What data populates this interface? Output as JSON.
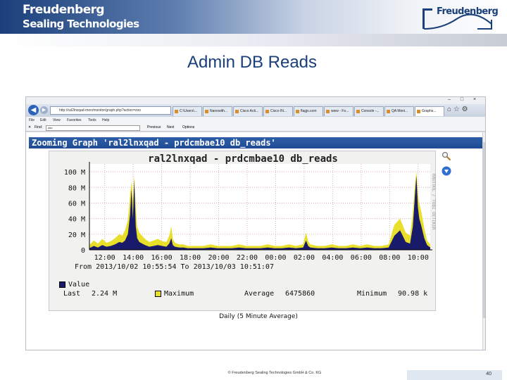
{
  "header": {
    "brand_line1": "Freudenberg",
    "brand_line2": "Sealing Technologies",
    "logo_text": "Freudenberg",
    "accent": "#1a3f7a"
  },
  "slide_title": "Admin DB Reads",
  "browser": {
    "url": "http://ral2lnxqad-mon/monitor/graph.php?action=zoo",
    "tabs": [
      "C:\\Users\\...",
      "Nanowith...",
      "Cisco Acti...",
      "Cisco IN...",
      "flagjs.com",
      "www - Fo...",
      "Console -...",
      "QA Moni...",
      "Graphs..."
    ],
    "menu": [
      "File",
      "Edit",
      "View",
      "Favorites",
      "Tools",
      "Help"
    ],
    "find_label": "Find:",
    "find_value": "zoo",
    "find_previous": "Previous",
    "find_next": "Next",
    "find_options": "Options",
    "window_controls": [
      "–",
      "□",
      "×"
    ]
  },
  "graph": {
    "zoom_header": "Zooming Graph 'ral2lnxqad - prdcmbae10 db_reads'",
    "side_label": "RRDTOOL / TOBI OETIKER",
    "footer_label": "Daily (5 Minute Average)"
  },
  "chart_data": {
    "type": "area",
    "title": "ral2lnxqad - prdcmbae10 db_reads",
    "subtitle": "From 2013/10/02 10:55:54 To 2013/10/03 10:51:07",
    "ylim": [
      0,
      110
    ],
    "y_unit": "M",
    "y_ticks": [
      "0",
      "20 M",
      "40 M",
      "60 M",
      "80 M",
      "100 M"
    ],
    "y_tick_values": [
      0,
      20,
      40,
      60,
      80,
      100
    ],
    "x_ticks": [
      "12:00",
      "14:00",
      "16:00",
      "18:00",
      "20:00",
      "22:00",
      "00:00",
      "02:00",
      "04:00",
      "06:00",
      "08:00",
      "10:00"
    ],
    "x_tick_hours": [
      1.07,
      3.07,
      5.07,
      7.07,
      9.07,
      11.07,
      13.07,
      15.07,
      17.07,
      19.07,
      21.07,
      23.07
    ],
    "x_range_hours": [
      0,
      23.92
    ],
    "grid": true,
    "series": [
      {
        "name": "Value",
        "color": "#1a1a6b",
        "x": [
          0,
          0.3,
          0.6,
          0.9,
          1.2,
          1.5,
          1.8,
          2.1,
          2.3,
          2.5,
          2.7,
          2.85,
          2.95,
          3.05,
          3.15,
          3.25,
          3.35,
          3.5,
          3.7,
          3.9,
          4.2,
          4.5,
          4.8,
          5.1,
          5.4,
          5.6,
          5.75,
          5.85,
          6.0,
          6.3,
          6.6,
          6.9,
          7.2,
          7.5,
          8.0,
          8.5,
          9.0,
          9.5,
          10.0,
          10.5,
          11.0,
          11.5,
          12.0,
          12.5,
          13.0,
          13.5,
          14.0,
          14.5,
          15.0,
          15.2,
          15.35,
          15.5,
          16.0,
          16.5,
          17.0,
          17.5,
          18.0,
          18.5,
          19.0,
          19.5,
          20.0,
          20.5,
          21.0,
          21.4,
          21.8,
          22.2,
          22.5,
          22.7,
          22.85,
          22.95,
          23.05,
          23.15,
          23.3,
          23.5,
          23.7,
          23.92
        ],
        "values": [
          2,
          5,
          3,
          6,
          4,
          5,
          7,
          10,
          9,
          12,
          20,
          45,
          78,
          40,
          90,
          30,
          15,
          10,
          8,
          6,
          4,
          5,
          6,
          5,
          4,
          8,
          15,
          6,
          4,
          3,
          3,
          2,
          2,
          2,
          2,
          3,
          2,
          2,
          2,
          3,
          2,
          2,
          2,
          3,
          2,
          2,
          3,
          2,
          3,
          12,
          5,
          3,
          2,
          2,
          3,
          2,
          2,
          3,
          2,
          3,
          2,
          2,
          3,
          18,
          25,
          10,
          8,
          30,
          70,
          95,
          55,
          40,
          30,
          15,
          6,
          3
        ]
      },
      {
        "name": "Maximum",
        "color": "#e8df2a",
        "x": [
          0,
          0.3,
          0.6,
          0.9,
          1.2,
          1.5,
          1.8,
          2.1,
          2.3,
          2.5,
          2.7,
          2.85,
          2.95,
          3.05,
          3.15,
          3.25,
          3.35,
          3.5,
          3.7,
          3.9,
          4.2,
          4.5,
          4.8,
          5.1,
          5.4,
          5.6,
          5.75,
          5.85,
          6.0,
          6.3,
          6.6,
          6.9,
          7.2,
          7.5,
          8.0,
          8.5,
          9.0,
          9.5,
          10.0,
          10.5,
          11.0,
          11.5,
          12.0,
          12.5,
          13.0,
          13.5,
          14.0,
          14.5,
          15.0,
          15.2,
          15.35,
          15.5,
          16.0,
          16.5,
          17.0,
          17.5,
          18.0,
          18.5,
          19.0,
          19.5,
          20.0,
          20.5,
          21.0,
          21.4,
          21.8,
          22.2,
          22.5,
          22.7,
          22.85,
          22.95,
          23.05,
          23.15,
          23.3,
          23.5,
          23.7,
          23.92
        ],
        "values": [
          6,
          12,
          8,
          14,
          9,
          11,
          15,
          20,
          18,
          25,
          38,
          70,
          88,
          62,
          95,
          55,
          30,
          22,
          18,
          14,
          10,
          12,
          14,
          11,
          10,
          18,
          30,
          14,
          9,
          7,
          7,
          5,
          5,
          5,
          5,
          7,
          5,
          5,
          5,
          7,
          5,
          5,
          5,
          7,
          5,
          5,
          7,
          5,
          7,
          22,
          11,
          7,
          5,
          5,
          7,
          5,
          5,
          7,
          5,
          7,
          5,
          5,
          7,
          32,
          40,
          22,
          18,
          48,
          85,
          100,
          72,
          60,
          48,
          28,
          12,
          7
        ]
      }
    ],
    "legend": {
      "value_label": "Value",
      "last_label": "Last",
      "last_value": "2.24 M",
      "maximum_label": "Maximum",
      "average_label": "Average",
      "average_value": "6475860",
      "minimum_label": "Minimum",
      "minimum_value": "90.98 k"
    }
  },
  "footer": {
    "copyright": "© Freudenberg Sealing Technologies GmbH & Co. KG",
    "page_number": "40"
  }
}
